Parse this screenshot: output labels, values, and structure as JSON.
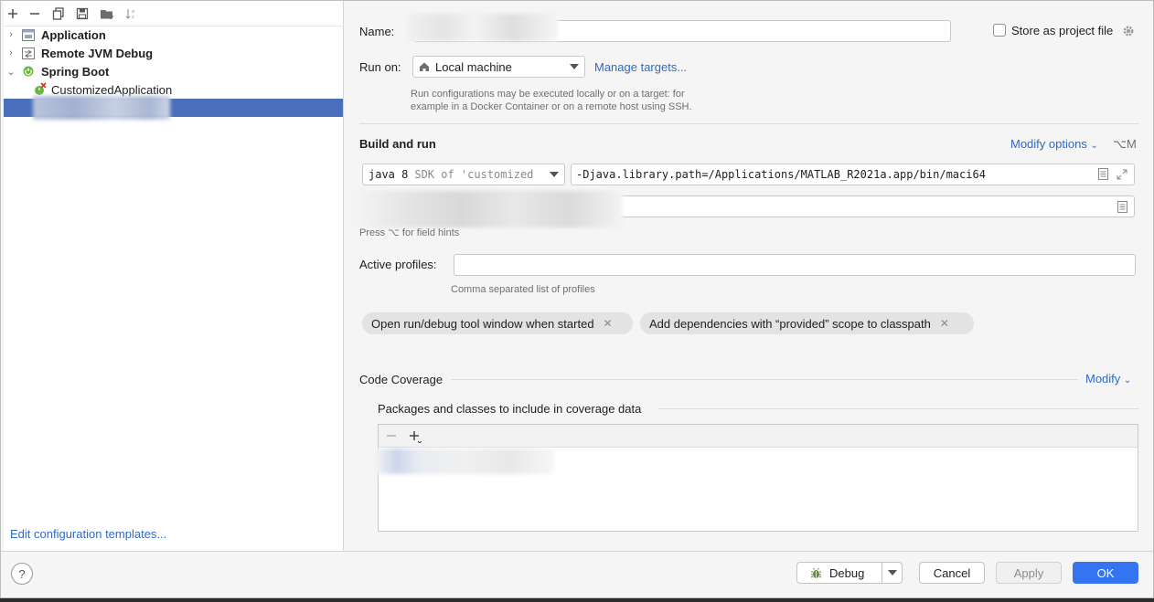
{
  "tree": {
    "items": [
      {
        "label": "Application",
        "expanded": false
      },
      {
        "label": "Remote JVM Debug",
        "expanded": false
      },
      {
        "label": "Spring Boot",
        "expanded": true
      }
    ],
    "children": [
      {
        "label": "CustomizedApplication"
      }
    ],
    "edit_templates": "Edit configuration templates..."
  },
  "form": {
    "name_label": "Name:",
    "store_as_project": "Store as project file",
    "run_on_label": "Run on:",
    "run_on_value": "Local machine",
    "manage_targets": "Manage targets...",
    "run_on_hint_1": "Run configurations may be executed locally or on a target: for",
    "run_on_hint_2": "example in a Docker Container or on a remote host using SSH.",
    "build_and_run": "Build and run",
    "modify_options": "Modify options",
    "modify_options_shortcut": "⌥M",
    "sdk_main": "java 8",
    "sdk_sub": "SDK of 'customized",
    "vm_options": "-Djava.library.path=/Applications/MATLAB_R2021a.app/bin/maci64",
    "field_hints": "Press ⌥ for field hints",
    "active_profiles_label": "Active profiles:",
    "active_profiles_value": "",
    "active_profiles_hint": "Comma separated list of profiles",
    "chips": [
      {
        "label": "Open run/debug tool window when started"
      },
      {
        "label": "Add dependencies with “provided” scope to classpath"
      }
    ],
    "code_coverage": "Code Coverage",
    "modify": "Modify",
    "packages_label": "Packages and classes to include in coverage data"
  },
  "buttons": {
    "debug": "Debug",
    "cancel": "Cancel",
    "apply": "Apply",
    "ok": "OK",
    "help": "?"
  },
  "colors": {
    "selection": "#4a6fba",
    "link": "#2e6ac9",
    "primary": "#3574f0"
  }
}
